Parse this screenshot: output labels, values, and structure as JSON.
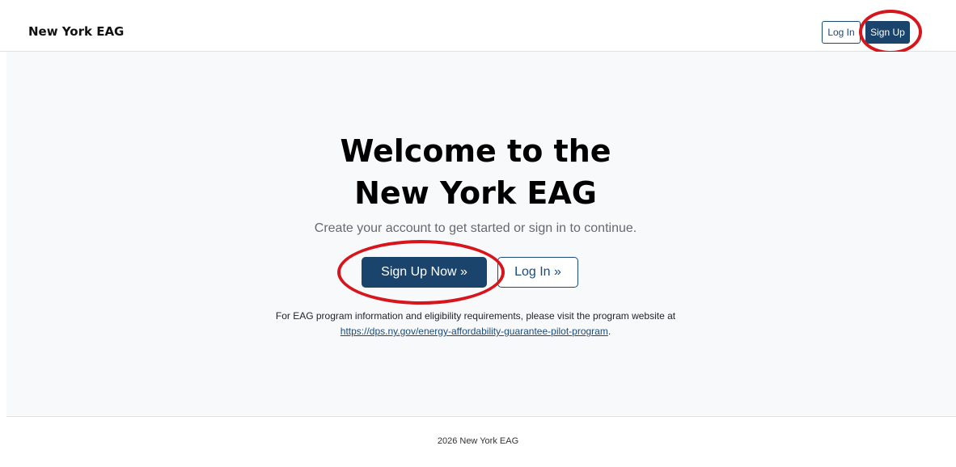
{
  "header": {
    "brand": "New York EAG",
    "login_label": "Log In",
    "signup_label": "Sign Up"
  },
  "hero": {
    "title_line1": "Welcome to the",
    "title_line2": "New York EAG",
    "subtitle": "Create your account to get started or sign in to continue.",
    "signup_button": "Sign Up Now »",
    "login_button": "Log In »",
    "info_text": "For EAG program information and eligibility requirements, please visit the program website at",
    "info_link": "https://dps.ny.gov/energy-affordability-guarantee-pilot-program",
    "info_period": "."
  },
  "footer": {
    "text": "2026 New York EAG"
  },
  "colors": {
    "primary": "#1b446d",
    "annotation": "#d6161c",
    "hero_bg": "#f8f9fa"
  }
}
